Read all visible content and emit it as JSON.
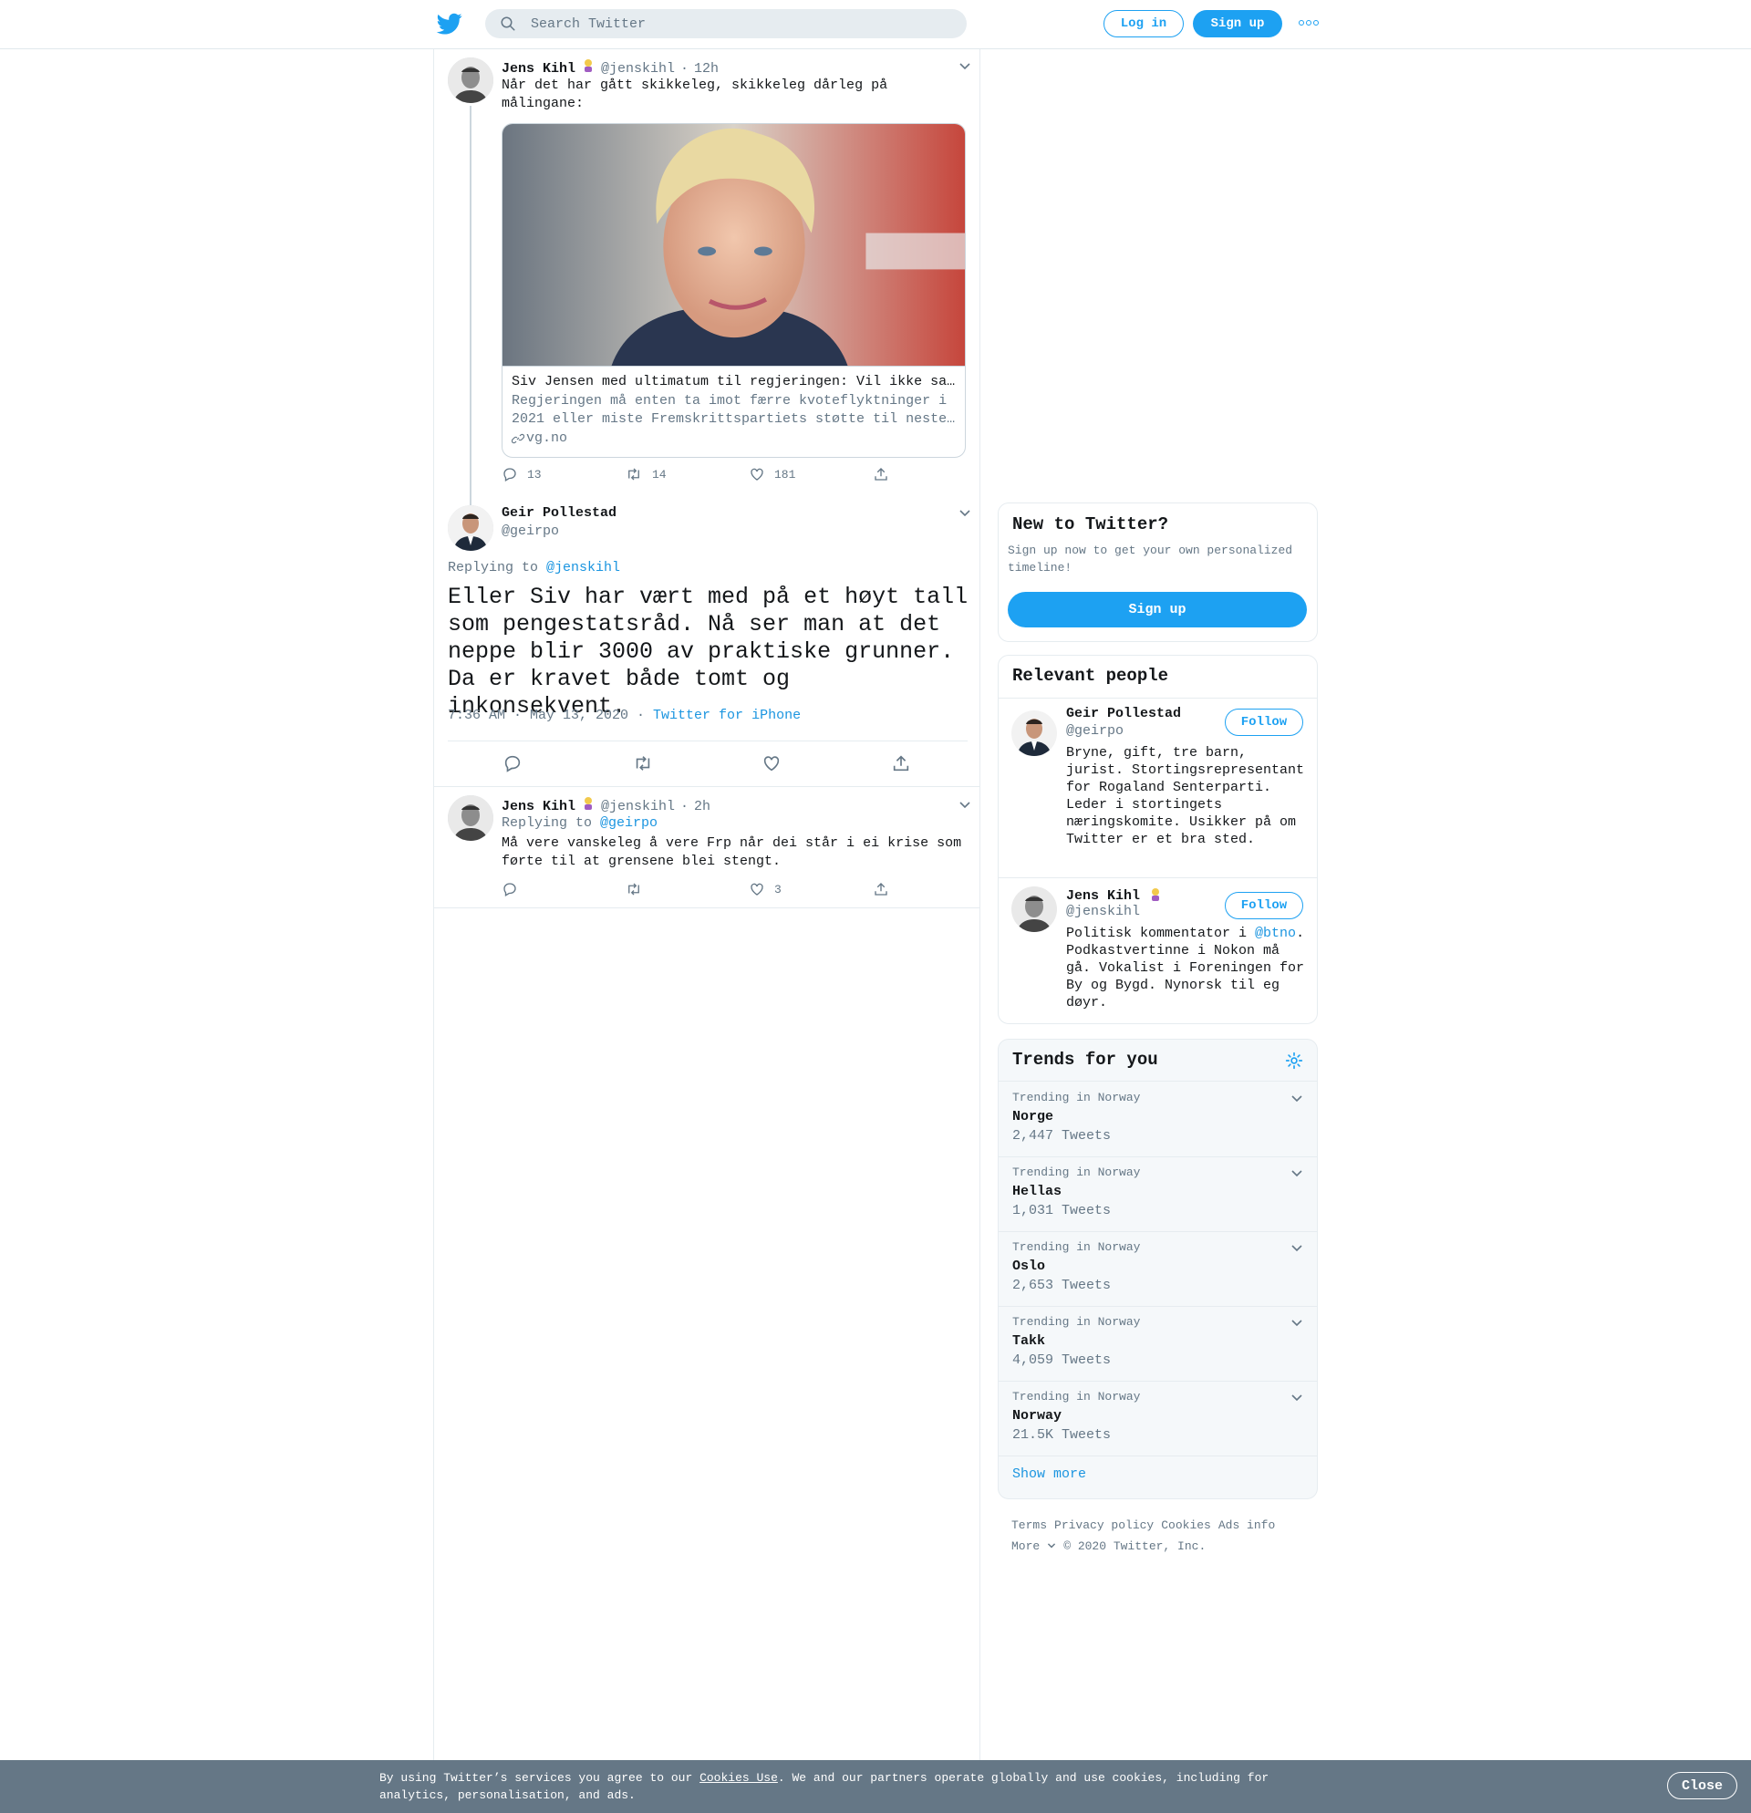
{
  "header": {
    "search_placeholder": "Search Twitter",
    "login_label": "Log in",
    "signup_label": "Sign up"
  },
  "colors": {
    "brand": "#1da1f2",
    "link": "#1b95e0",
    "muted": "#657786",
    "border": "#e6ecf0",
    "cookie_bg": "#657786"
  },
  "tweet_parent": {
    "name": "Jens Kihl",
    "handle": "@jenskihl",
    "time": "12h",
    "text": "Når det har gått skikkeleg, skikkeleg dårleg på målingane:",
    "card": {
      "title": "Siv Jensen med ultimatum til regjeringen: Vil ikke sa…",
      "description": "Regjeringen må enten ta imot færre kvoteflyktninger i 2021 eller miste Fremskrittspartiets støtte til neste…",
      "domain": "vg.no"
    },
    "replies": "13",
    "retweets": "14",
    "likes": "181"
  },
  "tweet_focus": {
    "name": "Geir Pollestad",
    "handle": "@geirpo",
    "replying_prefix": "Replying to ",
    "replying_to": "@jenskihl",
    "text": "Eller Siv har vært med på et høyt tall som pengestatsråd. Nå ser man at det neppe blir 3000 av praktiske grunner. Da er kravet både tomt og inkonsekvent.",
    "timestamp": "7:36 AM · May 13, 2020 · ",
    "source": "Twitter for iPhone"
  },
  "tweet_reply": {
    "name": "Jens Kihl",
    "handle": "@jenskihl",
    "time": "2h",
    "replying_prefix": "Replying to ",
    "replying_to": "@geirpo",
    "text": "Må vere vanskeleg å vere Frp når dei står i ei krise som førte til at grensene blei stengt.",
    "likes": "3"
  },
  "new_to_twitter": {
    "title": "New to Twitter?",
    "description": "Sign up now to get your own personalized timeline!",
    "button": "Sign up"
  },
  "relevant_people": {
    "title": "Relevant people",
    "follow_label": "Follow",
    "people": [
      {
        "name": "Geir Pollestad",
        "handle": "@geirpo",
        "bio": "Bryne, gift, tre barn, jurist. Stortingsrepresentant for Rogaland Senterparti. Leder i stortingets næringskomite. Usikker på om Twitter er et bra sted."
      },
      {
        "name": "Jens Kihl",
        "handle": "@jenskihl",
        "bio_prefix": "Politisk kommentator i ",
        "bio_mention": "@btno",
        "bio_suffix": ". Podkastvertinne i Nokon må gå. Vokalist i Foreningen for By og Bygd. Nynorsk til eg døyr."
      }
    ]
  },
  "trends": {
    "title": "Trends for you",
    "items": [
      {
        "context": "Trending in Norway",
        "name": "Norge",
        "count": "2,447 Tweets"
      },
      {
        "context": "Trending in Norway",
        "name": "Hellas",
        "count": "1,031 Tweets"
      },
      {
        "context": "Trending in Norway",
        "name": "Oslo",
        "count": "2,653 Tweets"
      },
      {
        "context": "Trending in Norway",
        "name": "Takk",
        "count": "4,059 Tweets"
      },
      {
        "context": "Trending in Norway",
        "name": "Norway",
        "count": "21.5K Tweets"
      }
    ],
    "show_more": "Show more"
  },
  "footer": {
    "links": [
      "Terms",
      "Privacy policy",
      "Cookies",
      "Ads info"
    ],
    "more": "More",
    "copyright": "© 2020 Twitter, Inc."
  },
  "cookie": {
    "text_prefix": "By using Twitter’s services you agree to our ",
    "link": "Cookies Use",
    "text_suffix": ". We and our partners operate globally and use cookies, including for analytics, personalisation, and ads.",
    "close": "Close"
  }
}
